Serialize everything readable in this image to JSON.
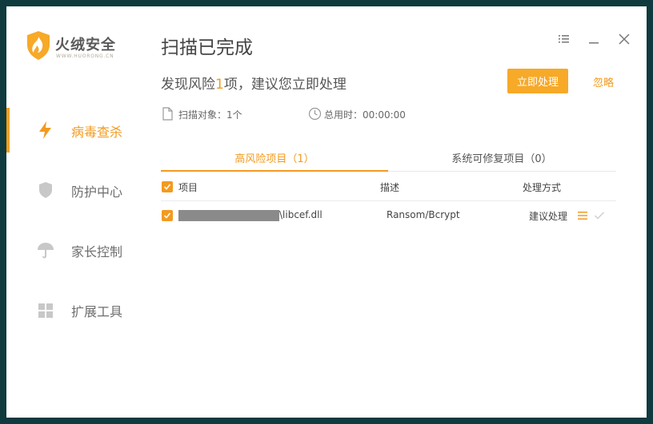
{
  "app": {
    "logo_cn": "火绒安全",
    "logo_en": "WWW.HUORONG.CN",
    "accent": "#f39a1f"
  },
  "sidebar": {
    "items": [
      {
        "label": "病毒查杀",
        "icon": "lightning-icon",
        "active": true
      },
      {
        "label": "防护中心",
        "icon": "shield-icon",
        "active": false
      },
      {
        "label": "家长控制",
        "icon": "umbrella-icon",
        "active": false
      },
      {
        "label": "扩展工具",
        "icon": "grid-icon",
        "active": false
      }
    ]
  },
  "header": {
    "title": "扫描已完成",
    "window_controls": [
      "menu-icon",
      "minimize-icon",
      "close-icon"
    ]
  },
  "summary": {
    "text_before": "发现风险",
    "count": "1",
    "text_after": "项，建议您立即处理",
    "primary_button": "立即处理",
    "ignore_button": "忽略"
  },
  "stats": {
    "scan_objects": "扫描对象：1个",
    "total_time": "总用时：00:00:00"
  },
  "tabs": [
    {
      "label": "高风险项目（1）",
      "active": true
    },
    {
      "label": "系统可修复项目（0）",
      "active": false
    }
  ],
  "table": {
    "columns": [
      "项目",
      "描述",
      "处理方式"
    ],
    "rows": [
      {
        "checked": true,
        "path_visible": "\\libcef.dll",
        "description": "Ransom/Bcrypt",
        "action": "建议处理"
      }
    ]
  }
}
